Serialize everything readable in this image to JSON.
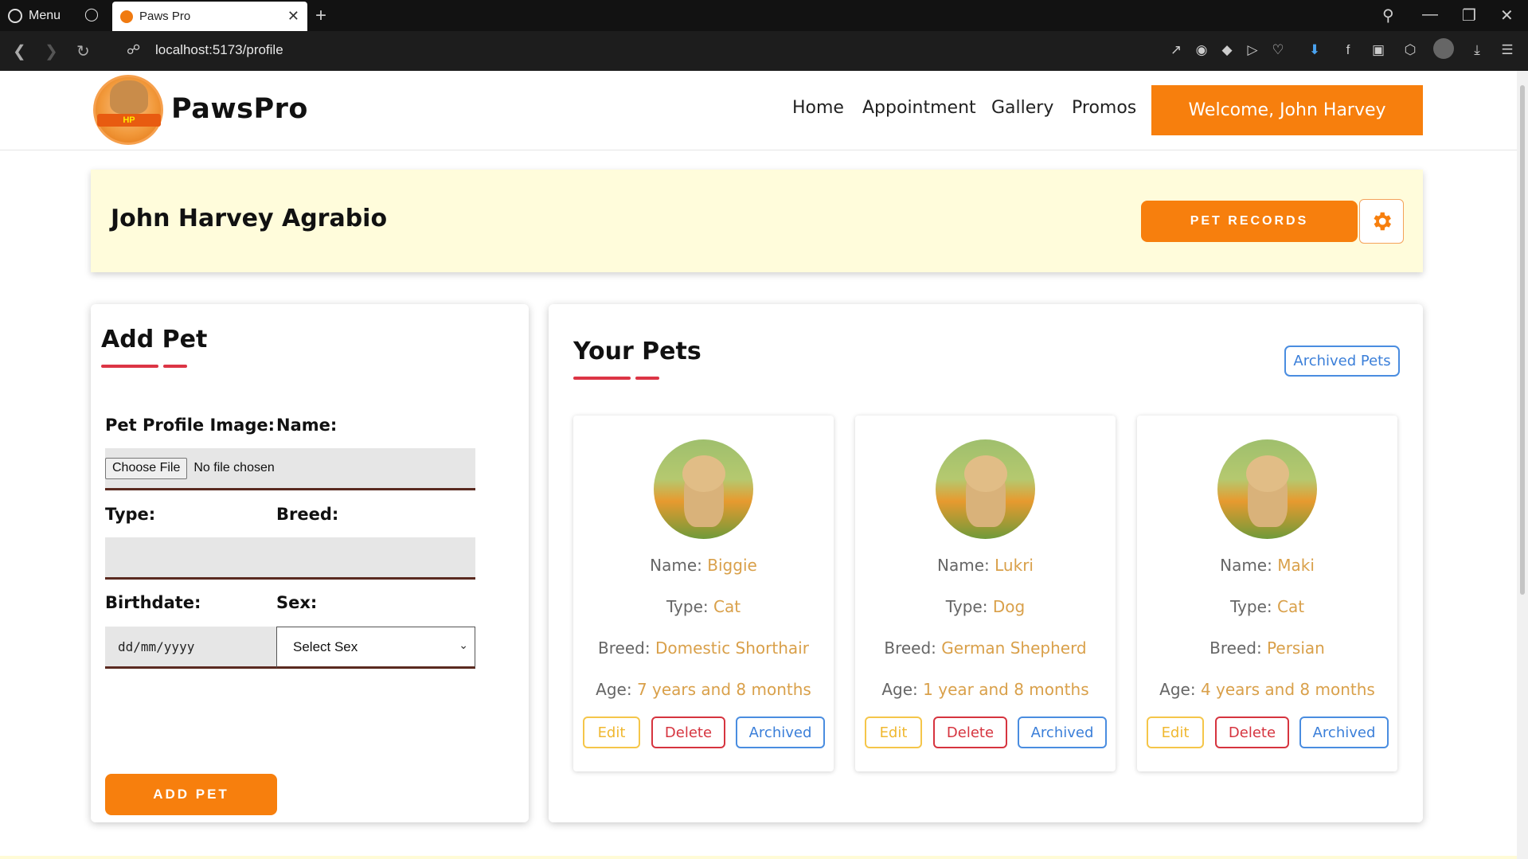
{
  "browser": {
    "menu_label": "Menu",
    "tab_title": "Paws Pro",
    "url": "localhost:5173/profile"
  },
  "header": {
    "brand": "PawsPro",
    "logo_text": "HP",
    "nav": [
      "Home",
      "Appointment",
      "Gallery",
      "Promos"
    ],
    "welcome": "Welcome, John Harvey"
  },
  "banner": {
    "name": "John Harvey Agrabio",
    "pet_records_label": "PET RECORDS"
  },
  "add_pet": {
    "title": "Add Pet",
    "labels": {
      "image": "Pet Profile Image:",
      "name": "Name:",
      "type": "Type:",
      "breed": "Breed:",
      "birthdate": "Birthdate:",
      "sex": "Sex:"
    },
    "file_button": "Choose File",
    "file_status": "No file chosen",
    "date_placeholder": "dd/mm/yyyy",
    "sex_selected": "Select Sex",
    "submit_label": "ADD PET"
  },
  "your_pets": {
    "title": "Your Pets",
    "archived_pets_label": "Archived Pets",
    "field_labels": {
      "name": "Name: ",
      "type": "Type: ",
      "breed": "Breed: ",
      "age": "Age: "
    },
    "buttons": {
      "edit": "Edit",
      "delete": "Delete",
      "archived": "Archived"
    },
    "pets": [
      {
        "name": "Biggie",
        "type": "Cat",
        "breed": "Domestic Shorthair",
        "age": "7 years and 8 months"
      },
      {
        "name": "Lukri",
        "type": "Dog",
        "breed": "German Shepherd",
        "age": "1 year and 8 months"
      },
      {
        "name": "Maki",
        "type": "Cat",
        "breed": "Persian",
        "age": "4 years and 8 months"
      }
    ]
  },
  "colors": {
    "accent_orange": "#f77f0d",
    "banner_bg": "#fffcdb",
    "value_gold": "#d9a04a",
    "danger_red": "#dc3545",
    "link_blue": "#3b7fd9"
  }
}
